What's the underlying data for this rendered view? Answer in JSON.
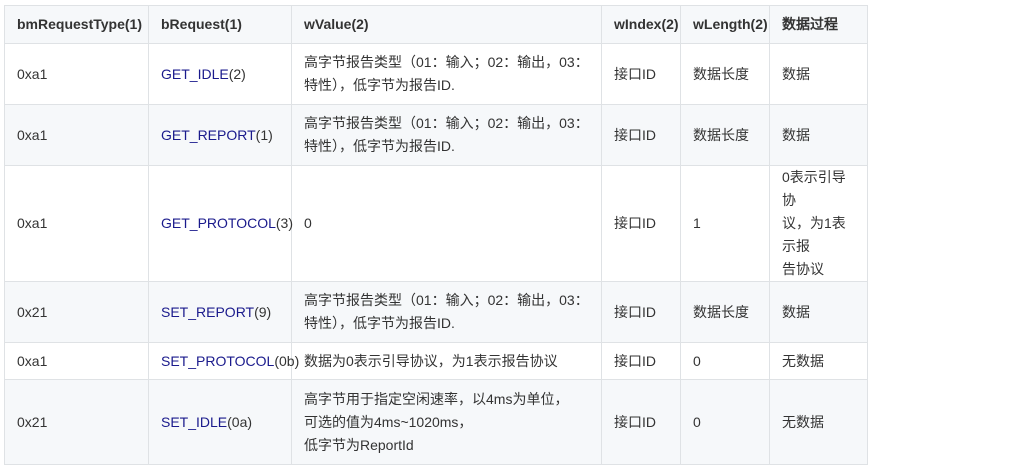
{
  "table": {
    "headers": [
      "bmRequestType(1)",
      "bRequest(1)",
      "wValue(2)",
      "wIndex(2)",
      "wLength(2)",
      "数据过程"
    ],
    "rows": [
      {
        "bmRequestType": "0xa1",
        "bRequest_name": "GET_IDLE",
        "bRequest_code": "(2)",
        "wValue_lines": [
          "高字节报告类型（01：输入；02：输出，03：",
          "特性），低字节为报告ID."
        ],
        "wIndex": "接口ID",
        "wLength": "数据长度",
        "data_lines": [
          "数据"
        ]
      },
      {
        "bmRequestType": "0xa1",
        "bRequest_name": "GET_REPORT",
        "bRequest_code": "(1)",
        "wValue_lines": [
          "高字节报告类型（01：输入；02：输出，03：",
          "特性），低字节为报告ID."
        ],
        "wIndex": "接口ID",
        "wLength": "数据长度",
        "data_lines": [
          "数据"
        ]
      },
      {
        "bmRequestType": "0xa1",
        "bRequest_name": "GET_PROTOCOL",
        "bRequest_code": "(3)",
        "wValue_lines": [
          "0"
        ],
        "wIndex": "接口ID",
        "wLength": "1",
        "data_lines": [
          "0表示引导协",
          "议，为1表示报",
          "告协议"
        ]
      },
      {
        "bmRequestType": "0x21",
        "bRequest_name": "SET_REPORT",
        "bRequest_code": "(9)",
        "wValue_lines": [
          "高字节报告类型（01：输入；02：输出，03：",
          "特性），低字节为报告ID."
        ],
        "wIndex": "接口ID",
        "wLength": "数据长度",
        "data_lines": [
          "数据"
        ]
      },
      {
        "bmRequestType": "0xa1",
        "bRequest_name": "SET_PROTOCOL",
        "bRequest_code": "(0b)",
        "wValue_lines": [
          "数据为0表示引导协议，为1表示报告协议"
        ],
        "wIndex": "接口ID",
        "wLength": "0",
        "data_lines": [
          "无数据"
        ]
      },
      {
        "bmRequestType": "0x21",
        "bRequest_name": "SET_IDLE",
        "bRequest_code": "(0a)",
        "wValue_lines": [
          "高字节用于指定空闲速率，以4ms为单位，",
          "可选的值为4ms~1020ms，",
          "低字节为ReportId"
        ],
        "wIndex": "接口ID",
        "wLength": "0",
        "data_lines": [
          "无数据"
        ]
      }
    ]
  }
}
